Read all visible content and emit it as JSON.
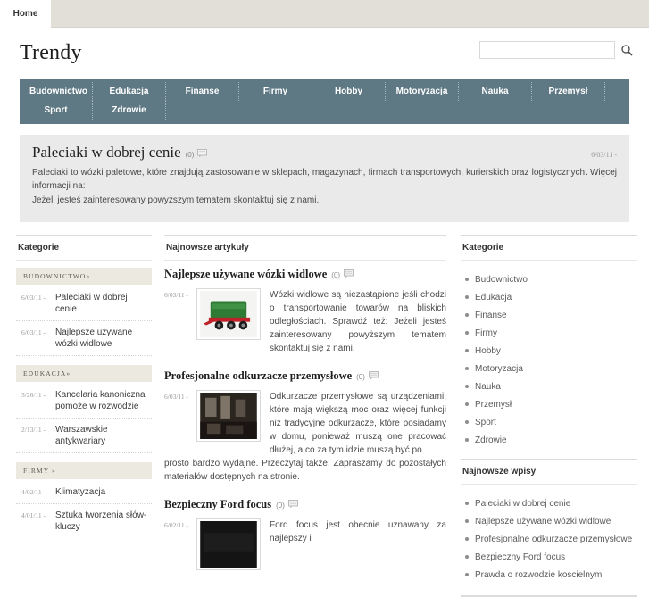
{
  "topbar": {
    "home_tab": "Home"
  },
  "header": {
    "brand": "Trendy",
    "search_value": "",
    "search_placeholder": "",
    "search_icon": "search-icon"
  },
  "nav": {
    "items": [
      "Budownictwo",
      "Edukacja",
      "Finanse",
      "Firmy",
      "Hobby",
      "Motoryzacja",
      "Nauka",
      "Przemysł",
      "Sport",
      "Zdrowie"
    ]
  },
  "feature": {
    "title": "Paleciaki w dobrej cenie",
    "comments": "(0)",
    "comment_icon": "comment-bubble-icon",
    "date": "6/03/11 -",
    "paragraph1": "Paleciaki to wózki paletowe, które znajdują zastosowanie w sklepach, magazynach, firmach transportowych, kurierskich oraz logistycznych. Więcej informacji na:",
    "paragraph2": "Jeżeli jesteś zainteresowany powyższym tematem skontaktuj się z nami."
  },
  "left_sidebar": {
    "title": "Kategorie",
    "groups": [
      {
        "name": "Budownictwo»",
        "posts": [
          {
            "date": "6/03/11 -",
            "title": "Paleciaki w dobrej cenie"
          },
          {
            "date": "6/03/11 -",
            "title": "Najlepsze używane wózki widlowe"
          }
        ]
      },
      {
        "name": "Edukacja»",
        "posts": [
          {
            "date": "3/26/11 -",
            "title": "Kancelaria kanoniczna pomoże w rozwodzie"
          },
          {
            "date": "2/13/11 -",
            "title": "Warszawskie antykwariary"
          }
        ]
      },
      {
        "name": "Firmy »",
        "posts": [
          {
            "date": "4/02/11 -",
            "title": "Klimatyzacja"
          },
          {
            "date": "4/01/11 -",
            "title": "Sztuka tworzenia słów-kluczy"
          }
        ]
      }
    ]
  },
  "center": {
    "title": "Najnowsze artykuły",
    "articles": [
      {
        "title": "Najlepsze używane wózki widlowe",
        "comments": "(0)",
        "date": "6/03/11 -",
        "thumb": "green-red-trailer-photo",
        "text": "Wózki widlowe są niezastąpione jeśli chodzi o transportowanie towarów na bliskich odległościach. Sprawdź też: Jeżeli jesteś zainteresowany powyższym tematem skontaktuj się z nami.",
        "tail": ""
      },
      {
        "title": "Profesjonalne odkurzacze przemysłowe",
        "comments": "(0)",
        "date": "6/03/11 -",
        "thumb": "dark-industrial-photo",
        "text": "Odkurzacze przemysłowe są urządzeniami, które mają większą moc oraz więcej funkcji niż tradycyjne odkurzacze, które posiadamy w domu, ponieważ muszą one pracować dłużej, a co za tym idzie muszą być po",
        "tail": "prosto bardzo wydajne. Przeczytaj także: Zapraszamy do pozostałych materiałów dostępnych na stronie."
      },
      {
        "title": "Bezpieczny Ford focus",
        "comments": "(0)",
        "date": "6/02/11 -",
        "thumb": "dark-car-photo",
        "text": "Ford focus jest obecnie uznawany za najlepszy i",
        "tail": ""
      }
    ]
  },
  "right_sidebar": {
    "categories_title": "Kategorie",
    "categories": [
      "Budownictwo",
      "Edukacja",
      "Finanse",
      "Firmy",
      "Hobby",
      "Motoryzacja",
      "Nauka",
      "Przemysł",
      "Sport",
      "Zdrowie"
    ],
    "recent_title": "Najnowsze wpisy",
    "recent": [
      "Paleciaki w dobrej cenie",
      "Najlepsze używane wózki widlowe",
      "Profesjonalne odkurzacze przemysłowe",
      "Bezpieczny Ford focus",
      "Prawda o rozwodzie koscielnym"
    ]
  },
  "colors": {
    "nav_bg": "#5e7884",
    "top_strip": "#e2dfd8",
    "feature_bg": "#eaeaea",
    "band_bg": "#ece9e1"
  }
}
